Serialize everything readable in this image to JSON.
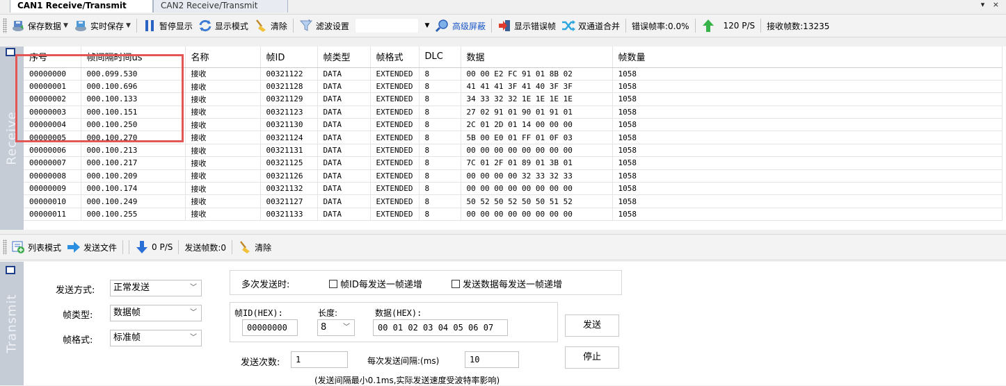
{
  "tabs": [
    {
      "label": "CAN1 Receive/Transmit",
      "active": true
    },
    {
      "label": "CAN2 Receive/Transmit",
      "active": false
    }
  ],
  "window_controls": "▾ ×",
  "receive_toolbar": {
    "save_data": "保存数据",
    "realtime_save": "实时保存",
    "pause_display": "暂停显示",
    "display_mode": "显示模式",
    "clear": "清除",
    "filter_settings": "滤波设置",
    "filter_value": "",
    "advanced_mask": "高级屏蔽",
    "show_error_frames": "显示错误帧",
    "dual_channel_merge": "双通道合并",
    "error_rate": "错误帧率:0.0%",
    "rate": "120 P/S",
    "received_count": "接收帧数:13235"
  },
  "receive_side_label": "Receive",
  "table": {
    "columns": [
      "序号",
      "帧间隔时间us",
      "名称",
      "帧ID",
      "帧类型",
      "帧格式",
      "DLC",
      "数据",
      "帧数量"
    ],
    "rows": [
      [
        "00000000",
        "000.099.530",
        "接收",
        "00321122",
        "DATA",
        "EXTENDED",
        "8",
        "00 00 E2 FC 91 01 8B 02",
        "1058"
      ],
      [
        "00000001",
        "000.100.696",
        "接收",
        "00321128",
        "DATA",
        "EXTENDED",
        "8",
        "41 41 41 3F 41 40 3F 3F",
        "1058"
      ],
      [
        "00000002",
        "000.100.133",
        "接收",
        "00321129",
        "DATA",
        "EXTENDED",
        "8",
        "34 33 32 32 1E 1E 1E 1E",
        "1058"
      ],
      [
        "00000003",
        "000.100.151",
        "接收",
        "00321123",
        "DATA",
        "EXTENDED",
        "8",
        "27 02 91 01 90 01 91 01",
        "1058"
      ],
      [
        "00000004",
        "000.100.250",
        "接收",
        "00321130",
        "DATA",
        "EXTENDED",
        "8",
        "2C 01 2D 01 14 00 00 00",
        "1058"
      ],
      [
        "00000005",
        "000.100.270",
        "接收",
        "00321124",
        "DATA",
        "EXTENDED",
        "8",
        "5B 00 E0 01 FF 01 0F 03",
        "1058"
      ],
      [
        "00000006",
        "000.100.213",
        "接收",
        "00321131",
        "DATA",
        "EXTENDED",
        "8",
        "00 00 00 00 00 00 00 00",
        "1058"
      ],
      [
        "00000007",
        "000.100.217",
        "接收",
        "00321125",
        "DATA",
        "EXTENDED",
        "8",
        "7C 01 2F 01 89 01 3B 01",
        "1058"
      ],
      [
        "00000008",
        "000.100.209",
        "接收",
        "00321126",
        "DATA",
        "EXTENDED",
        "8",
        "00 00 00 00 32 33 32 33",
        "1058"
      ],
      [
        "00000009",
        "000.100.174",
        "接收",
        "00321132",
        "DATA",
        "EXTENDED",
        "8",
        "00 00 00 00 00 00 00 00",
        "1058"
      ],
      [
        "00000010",
        "000.100.249",
        "接收",
        "00321127",
        "DATA",
        "EXTENDED",
        "8",
        "50 52 50 52 50 50 51 52",
        "1058"
      ],
      [
        "00000011",
        "000.100.255",
        "接收",
        "00321133",
        "DATA",
        "EXTENDED",
        "8",
        "00 00 00 00 00 00 00 00",
        "1058"
      ]
    ]
  },
  "send_toolbar": {
    "list_mode": "列表模式",
    "send_file": "发送文件",
    "rate": "0 P/S",
    "sent_count": "发送帧数:0",
    "clear": "清除"
  },
  "transmit_side_label": "Transmit",
  "transmit": {
    "send_mode_label": "发送方式:",
    "send_mode_value": "正常发送",
    "frame_type_label": "帧类型:",
    "frame_type_value": "数据帧",
    "frame_format_label": "帧格式:",
    "frame_format_value": "标准帧",
    "multi_send_label": "多次发送时:",
    "id_increment_label": "帧ID每发送一帧递增",
    "data_increment_label": "发送数据每发送一帧递增",
    "frame_id_label": "帧ID(HEX):",
    "frame_id_value": "00000000",
    "length_label": "长度:",
    "length_value": "8",
    "data_label": "数据(HEX):",
    "data_value": "00 01 02 03 04 05 06 07",
    "send_button": "发送",
    "send_count_label": "发送次数:",
    "send_count_value": "1",
    "interval_label": "每次发送间隔:(ms)",
    "interval_value": "10",
    "stop_button": "停止",
    "note": "(发送间隔最小0.1ms,实际发送速度受波特率影响)"
  },
  "colors": {
    "highlight": "#e25656",
    "side_panel": "#c6ccd6",
    "link_blue": "#1a56c8"
  }
}
